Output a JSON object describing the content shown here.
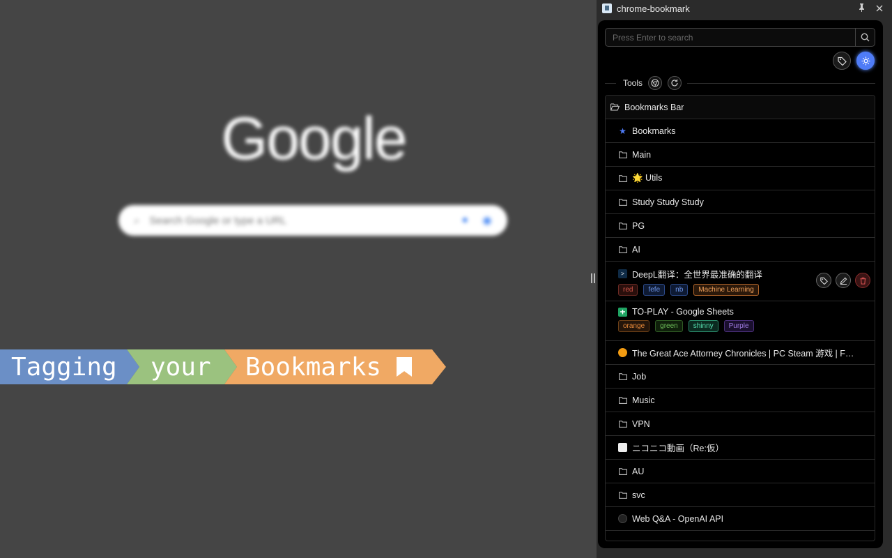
{
  "background": {
    "logo_text": "Google",
    "search_placeholder": "Search Google or type a URL"
  },
  "banner": {
    "words": [
      "Tagging",
      "your",
      "Bookmarks"
    ],
    "colors": {
      "blue": "#6b8fc6",
      "green": "#9bc27f",
      "orange": "#f0a964"
    }
  },
  "panel": {
    "title": "chrome-bookmark",
    "pin_icon": "pin-icon",
    "close_icon": "close-icon",
    "search": {
      "placeholder": "Press Enter to search"
    },
    "tools_label": "Tools",
    "accent": "#4f7cf7",
    "tree": {
      "root": "Bookmarks Bar",
      "items": [
        {
          "type": "star",
          "label": "Bookmarks"
        },
        {
          "type": "folder",
          "label": "Main"
        },
        {
          "type": "folder",
          "label": "🌟 Utils"
        },
        {
          "type": "folder",
          "label": "Study Study Study"
        },
        {
          "type": "folder",
          "label": "PG"
        },
        {
          "type": "folder",
          "label": "AI"
        },
        {
          "type": "link",
          "favicon": "deepl",
          "label": "DeepL翻译：全世界最准确的翻译",
          "tags": [
            {
              "text": "red",
              "color": "#c0392b"
            },
            {
              "text": "fefe",
              "color": "#3a6fd8"
            },
            {
              "text": "nb",
              "color": "#3a6fd8"
            },
            {
              "text": "Machine Learning",
              "color": "#e8893a"
            }
          ]
        },
        {
          "type": "link",
          "favicon": "sheets",
          "label": "TO-PLAY - Google Sheets",
          "tags": [
            {
              "text": "orange",
              "color": "#e8893a"
            },
            {
              "text": "green",
              "color": "#4caf50"
            },
            {
              "text": "shinny",
              "color": "#2ecc9a"
            },
            {
              "text": "Purple",
              "color": "#8e5cd9"
            }
          ]
        },
        {
          "type": "link",
          "favicon": "steam",
          "label": "The Great Ace Attorney Chronicles | PC Steam 游戏 | Fa..."
        },
        {
          "type": "folder",
          "label": "Job"
        },
        {
          "type": "folder",
          "label": "Music"
        },
        {
          "type": "folder",
          "label": "VPN"
        },
        {
          "type": "link",
          "favicon": "nico",
          "label": "ニコニコ動画（Re:仮）"
        },
        {
          "type": "folder",
          "label": "AU"
        },
        {
          "type": "folder",
          "label": "svc"
        },
        {
          "type": "link",
          "favicon": "openai",
          "label": "Web Q&A - OpenAI API"
        }
      ]
    }
  }
}
